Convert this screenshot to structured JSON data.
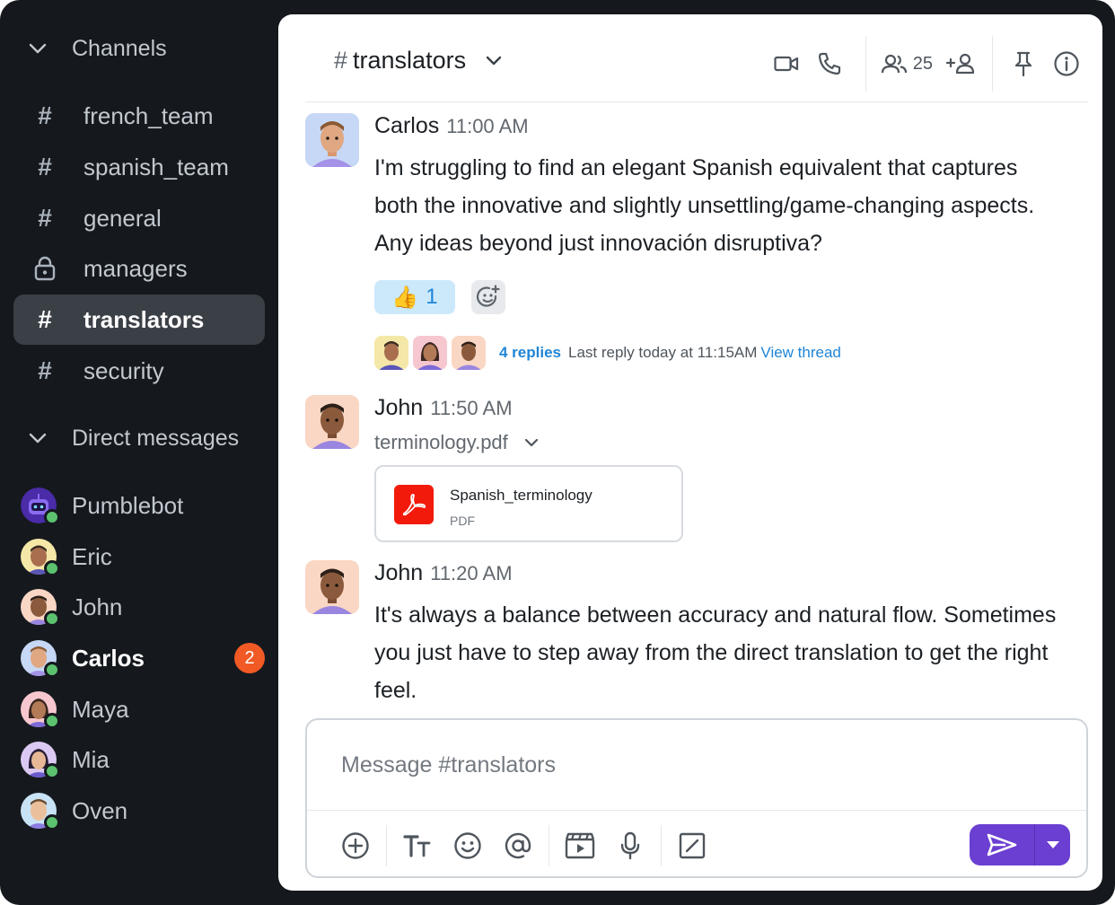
{
  "sidebar": {
    "channels_header": "Channels",
    "channels": [
      {
        "label": "french_team",
        "icon": "hash-icon"
      },
      {
        "label": "spanish_team",
        "icon": "hash-icon"
      },
      {
        "label": "general",
        "icon": "hash-icon"
      },
      {
        "label": "managers",
        "icon": "lock-icon"
      },
      {
        "label": "translators",
        "icon": "hash-icon",
        "active": true
      },
      {
        "label": "security",
        "icon": "hash-icon"
      }
    ],
    "dm_header": "Direct messages",
    "direct_messages": [
      {
        "label": "Pumblebot"
      },
      {
        "label": "Eric"
      },
      {
        "label": "John"
      },
      {
        "label": "Carlos",
        "unread": "2"
      },
      {
        "label": "Maya"
      },
      {
        "label": "Mia"
      },
      {
        "label": "Oven"
      }
    ]
  },
  "header": {
    "hash": "#",
    "channel_name": "translators",
    "member_count": "25"
  },
  "messages": [
    {
      "author": "Carlos",
      "time": "11:00 AM",
      "lines": [
        "I'm struggling to find an elegant Spanish equivalent that captures",
        "both the innovative and slightly unsettling/game-changing aspects.",
        "Any ideas beyond just innovación disruptiva?"
      ],
      "reaction": {
        "emoji": "👍",
        "count": "1"
      },
      "thread": {
        "replies": "4 replies",
        "last_reply": "Last reply today at 11:15AM",
        "view": "View thread"
      }
    },
    {
      "author": "John",
      "time": "11:50 AM",
      "file_label": "terminology.pdf",
      "attachment": {
        "name": "Spanish_terminology",
        "type": "PDF"
      }
    },
    {
      "author": "John",
      "time": "11:20 AM",
      "lines": [
        "It's always a balance between accuracy and natural flow. Sometimes",
        "you just have to step away from the direct translation to get the right",
        "feel."
      ]
    }
  ],
  "composer": {
    "placeholder": "Message #translators"
  },
  "colors": {
    "sidebar_bg": "#15191e",
    "accent_purple": "#6b3fd1",
    "link_blue": "#1f85d6",
    "unread_badge": "#f15a24",
    "online": "#5cc26f",
    "pdf_red": "#f21a0a"
  }
}
